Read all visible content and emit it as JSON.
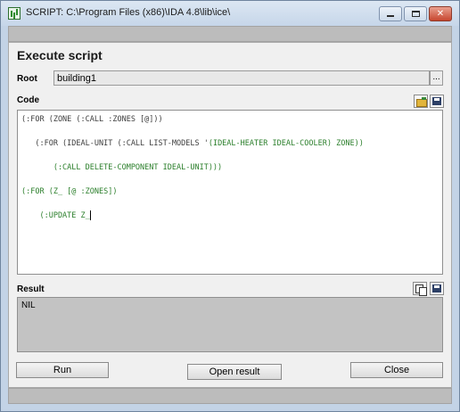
{
  "window": {
    "title": "SCRIPT: C:\\Program Files (x86)\\IDA 4.8\\lib\\ice\\",
    "minimize_glyph": "",
    "maximize_glyph": "",
    "close_glyph": "✕"
  },
  "dialog": {
    "heading": "Execute script",
    "root_label": "Root",
    "root_value": "building1",
    "browse_label": "...",
    "code_label": "Code",
    "result_label": "Result",
    "result_value": "NIL"
  },
  "code_lines": [
    {
      "a": "(:FOR (ZONE (:CALL :ZONES [@]))",
      "b": ""
    },
    {
      "a": "   (:FOR (IDEAL-UNIT (:CALL LIST-MODELS '",
      "b": "(IDEAL-HEATER IDEAL-COOLER) ZONE))"
    },
    {
      "a": "",
      "b": "       (:CALL DELETE-COMPONENT IDEAL-UNIT)))"
    },
    {
      "a": "",
      "b": "(:FOR (Z_ [@ :ZONES])"
    },
    {
      "a": "",
      "b": "    (:UPDATE Z_"
    }
  ],
  "buttons": {
    "run": "Run",
    "open_result": "Open result",
    "close": "Close"
  },
  "colors": {
    "code_dark": "#3d3d3d",
    "code_green": "#2b7f2b"
  }
}
